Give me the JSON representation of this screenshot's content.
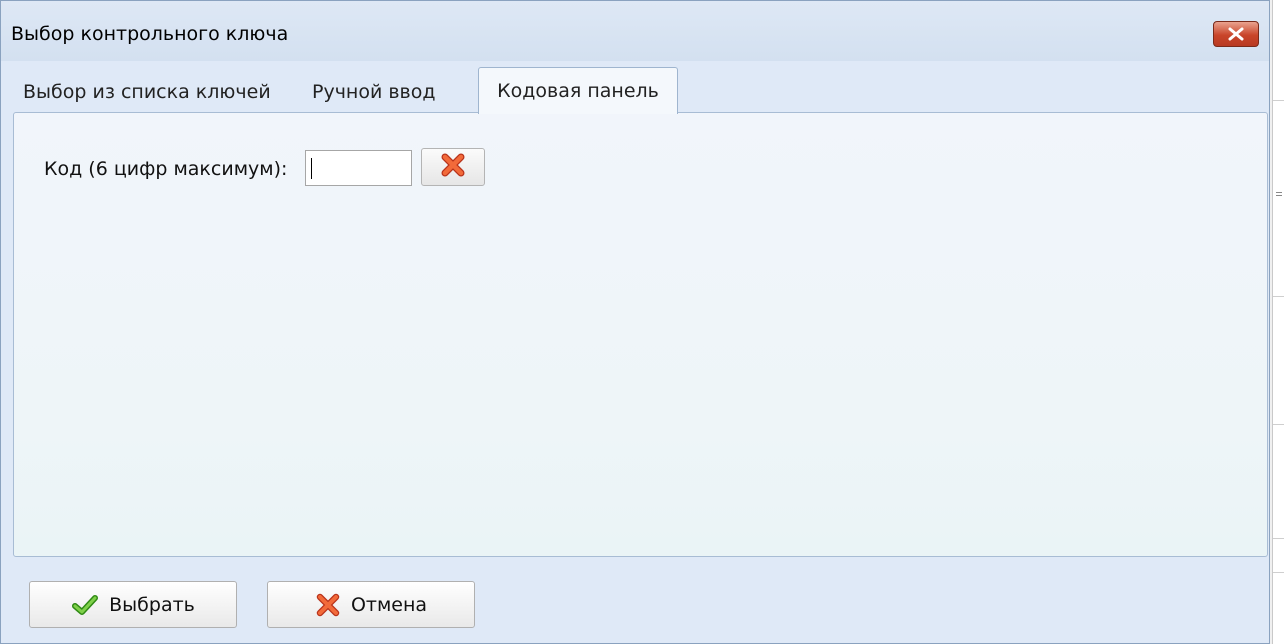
{
  "window": {
    "title": "Выбор контрольного ключа"
  },
  "tabs": [
    {
      "label": "Выбор из списка ключей",
      "active": false
    },
    {
      "label": "Ручной ввод",
      "active": false
    },
    {
      "label": "Кодовая панель",
      "active": true
    }
  ],
  "code_panel": {
    "label": "Код (6 цифр максимум):",
    "value": ""
  },
  "buttons": {
    "select_label": "Выбрать",
    "cancel_label": "Отмена"
  },
  "icons": {
    "close": "close-icon",
    "clear": "red-x-icon",
    "select": "green-check-icon",
    "cancel": "red-x-icon"
  },
  "colors": {
    "dialog_bg": "#dfe9f7",
    "close_button": "#c9452a",
    "check_green": "#3a9a1a",
    "x_red": "#e0401a"
  }
}
